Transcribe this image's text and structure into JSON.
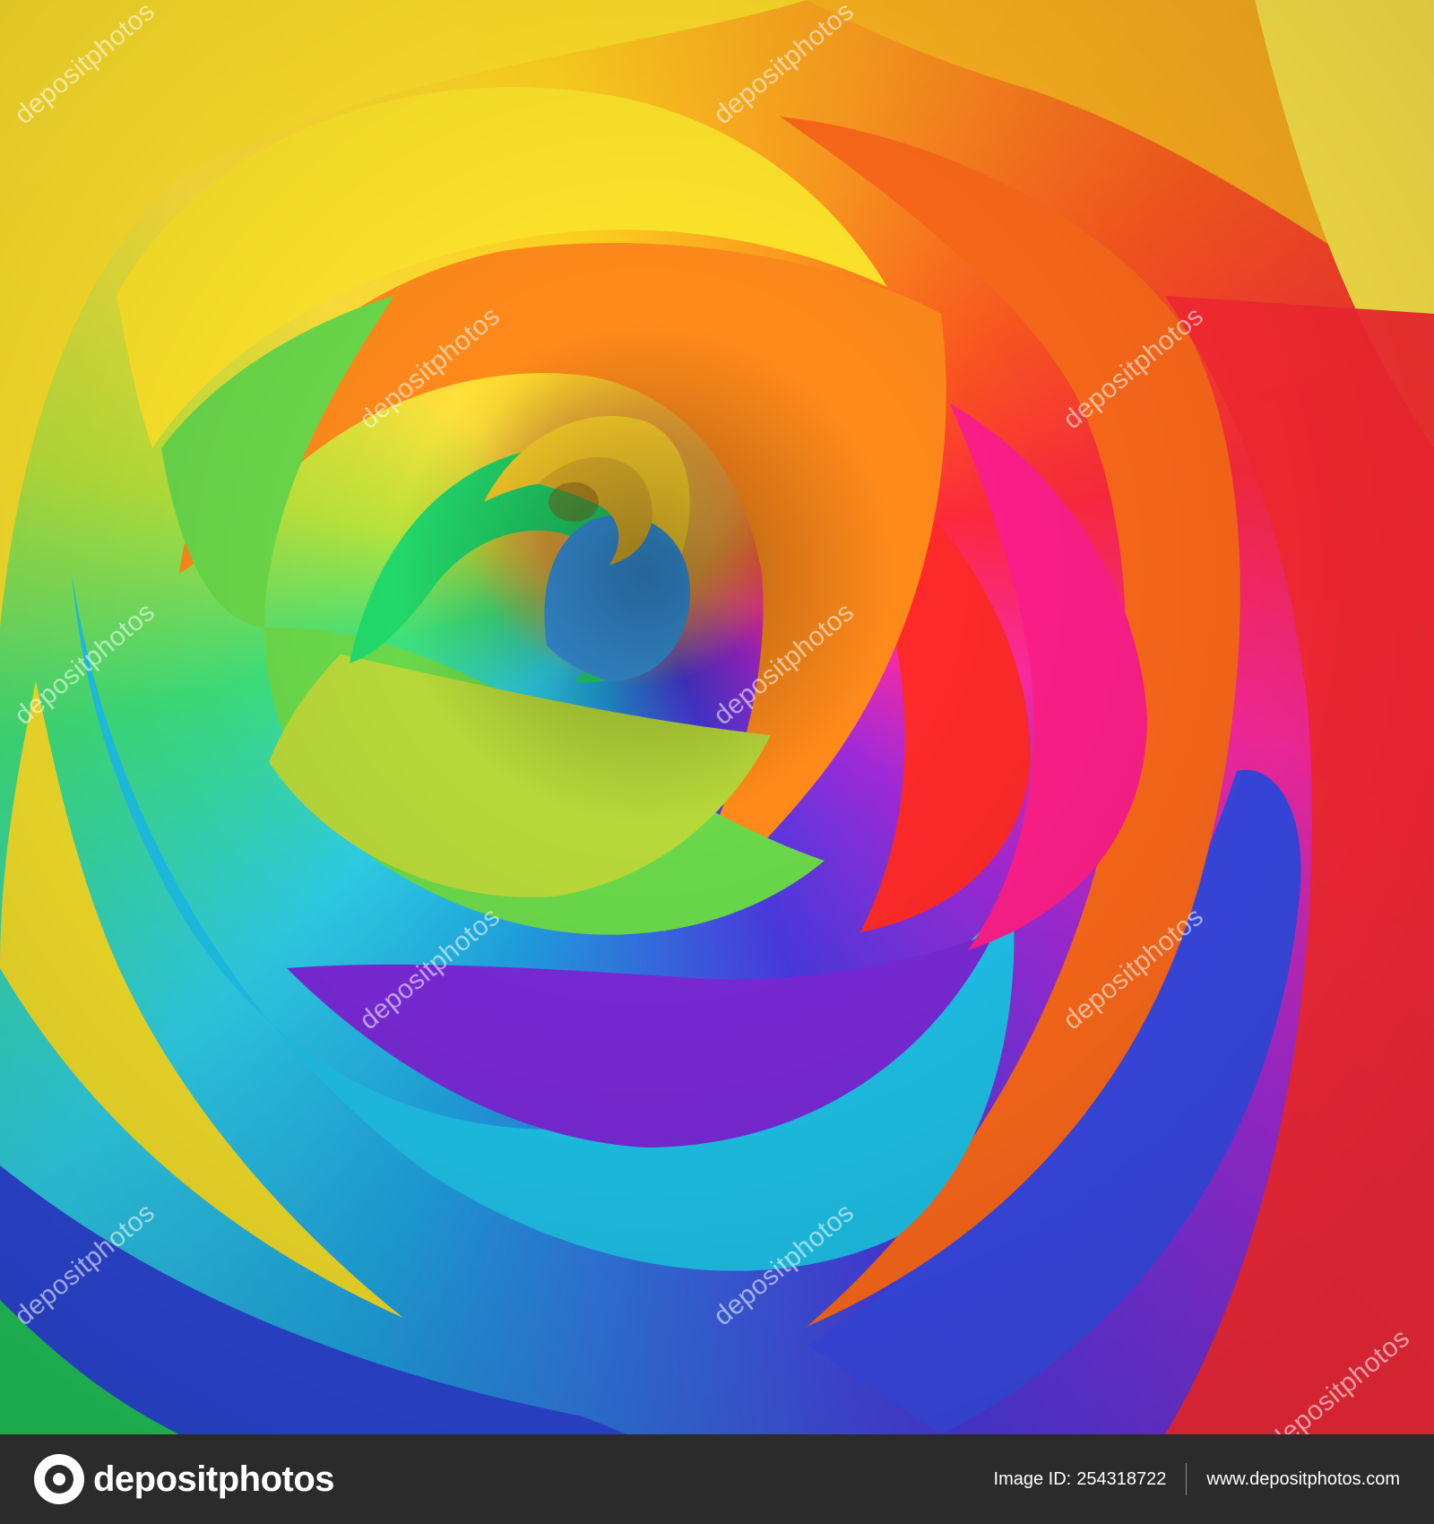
{
  "watermark": {
    "text": "depositphotos"
  },
  "footer": {
    "logo_text": "depositphotos",
    "image_id_label": "Image ID:",
    "image_id": "254318722",
    "site_url": "www.depositphotos.com"
  },
  "colors": {
    "footer_bg": "#2b2b2b",
    "footer_text": "#ffffff"
  }
}
